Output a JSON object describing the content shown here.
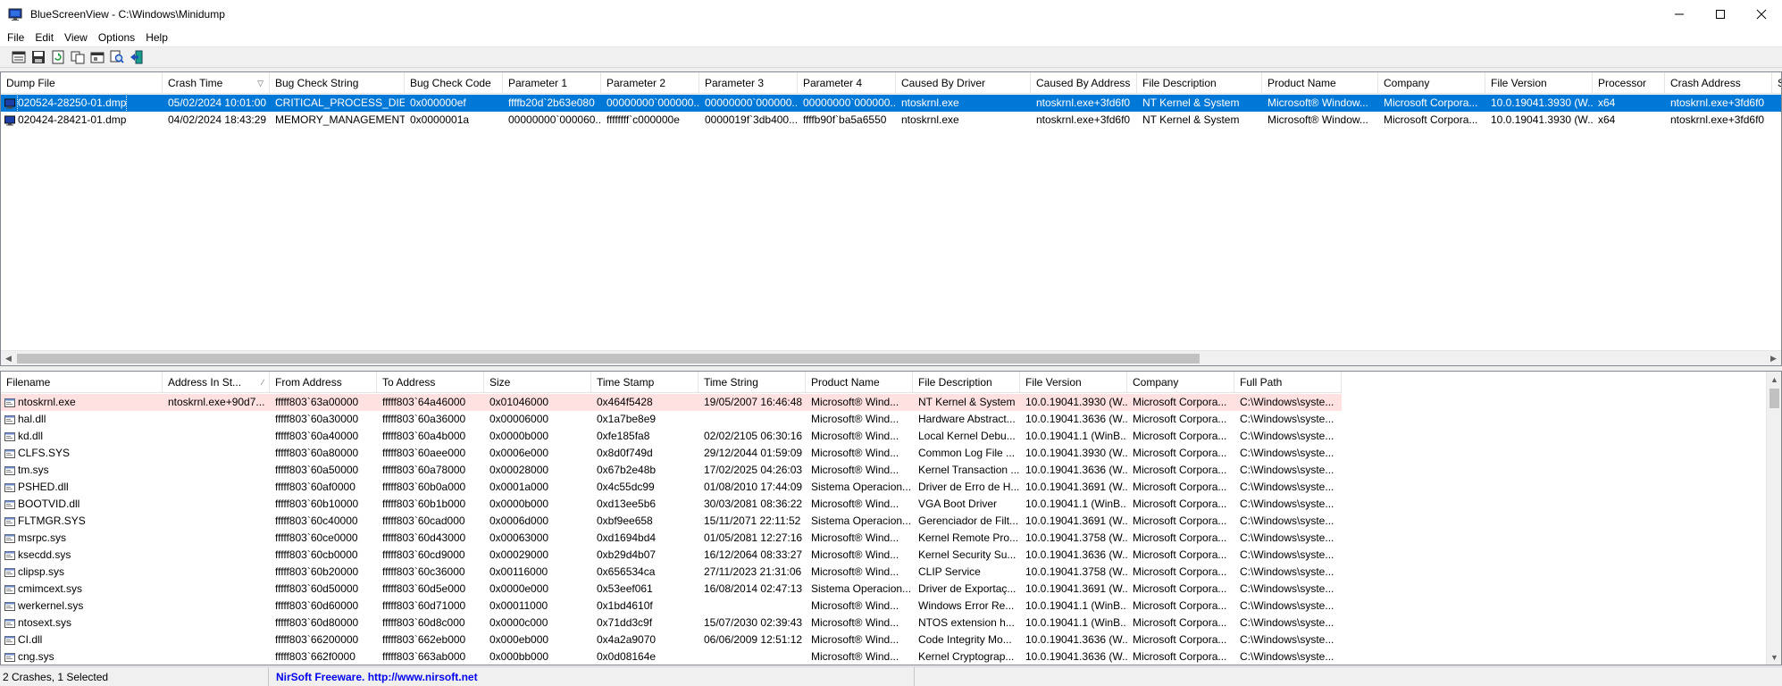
{
  "window": {
    "title": "BlueScreenView  -  C:\\Windows\\Minidump",
    "app_icon": "bluescreen-monitor-icon",
    "controls": [
      "minimize-icon",
      "maximize-icon",
      "close-icon"
    ]
  },
  "menu": [
    "File",
    "Edit",
    "View",
    "Options",
    "Help"
  ],
  "toolbar": [
    "properties-icon",
    "save-icon",
    "refresh-icon",
    "copy-icon",
    "advanced-options-icon",
    "find-icon",
    "exit-icon"
  ],
  "top_table": {
    "columns": [
      {
        "label": "Dump File",
        "sort": ""
      },
      {
        "label": "Crash Time",
        "sort": "▽"
      },
      {
        "label": "Bug Check String",
        "sort": ""
      },
      {
        "label": "Bug Check Code",
        "sort": ""
      },
      {
        "label": "Parameter 1",
        "sort": ""
      },
      {
        "label": "Parameter 2",
        "sort": ""
      },
      {
        "label": "Parameter 3",
        "sort": ""
      },
      {
        "label": "Parameter 4",
        "sort": ""
      },
      {
        "label": "Caused By Driver",
        "sort": ""
      },
      {
        "label": "Caused By Address",
        "sort": ""
      },
      {
        "label": "File Description",
        "sort": ""
      },
      {
        "label": "Product Name",
        "sort": ""
      },
      {
        "label": "Company",
        "sort": ""
      },
      {
        "label": "File Version",
        "sort": ""
      },
      {
        "label": "Processor",
        "sort": ""
      },
      {
        "label": "Crash Address",
        "sort": ""
      },
      {
        "label": "S",
        "sort": ""
      }
    ],
    "rows": [
      {
        "selected": true,
        "cells": [
          "020524-28250-01.dmp",
          "05/02/2024 10:01:00",
          "CRITICAL_PROCESS_DIED",
          "0x000000ef",
          "ffffb20d`2b63e080",
          "00000000`000000...",
          "00000000`000000...",
          "00000000`000000...",
          "ntoskrnl.exe",
          "ntoskrnl.exe+3fd6f0",
          "NT Kernel & System",
          "Microsoft® Window...",
          "Microsoft Corpora...",
          "10.0.19041.3930 (W...",
          "x64",
          "ntoskrnl.exe+3fd6f0",
          ""
        ]
      },
      {
        "selected": false,
        "cells": [
          "020424-28421-01.dmp",
          "04/02/2024 18:43:29",
          "MEMORY_MANAGEMENT",
          "0x0000001a",
          "00000000`000060...",
          "ffffffff`c000000e",
          "0000019f`3db400...",
          "ffffb90f`ba5a6550",
          "ntoskrnl.exe",
          "ntoskrnl.exe+3fd6f0",
          "NT Kernel & System",
          "Microsoft® Window...",
          "Microsoft Corpora...",
          "10.0.19041.3930 (W...",
          "x64",
          "ntoskrnl.exe+3fd6f0",
          ""
        ]
      }
    ]
  },
  "bottom_table": {
    "columns": [
      {
        "label": "Filename",
        "sort": ""
      },
      {
        "label": "Address In St...",
        "sort": "∕"
      },
      {
        "label": "From Address",
        "sort": ""
      },
      {
        "label": "To Address",
        "sort": ""
      },
      {
        "label": "Size",
        "sort": ""
      },
      {
        "label": "Time Stamp",
        "sort": ""
      },
      {
        "label": "Time String",
        "sort": ""
      },
      {
        "label": "Product Name",
        "sort": ""
      },
      {
        "label": "File Description",
        "sort": ""
      },
      {
        "label": "File Version",
        "sort": ""
      },
      {
        "label": "Company",
        "sort": ""
      },
      {
        "label": "Full Path",
        "sort": ""
      }
    ],
    "rows": [
      {
        "highlight": true,
        "cells": [
          "ntoskrnl.exe",
          "ntoskrnl.exe+90d7...",
          "fffff803`63a00000",
          "fffff803`64a46000",
          "0x01046000",
          "0x464f5428",
          "19/05/2007 16:46:48",
          "Microsoft® Wind...",
          "NT Kernel & System",
          "10.0.19041.3930 (W...",
          "Microsoft Corpora...",
          "C:\\Windows\\syste..."
        ]
      },
      {
        "highlight": false,
        "cells": [
          "hal.dll",
          "",
          "fffff803`60a30000",
          "fffff803`60a36000",
          "0x00006000",
          "0x1a7be8e9",
          "",
          "Microsoft® Wind...",
          "Hardware Abstract...",
          "10.0.19041.3636 (W...",
          "Microsoft Corpora...",
          "C:\\Windows\\syste..."
        ]
      },
      {
        "highlight": false,
        "cells": [
          "kd.dll",
          "",
          "fffff803`60a40000",
          "fffff803`60a4b000",
          "0x0000b000",
          "0xfe185fa8",
          "02/02/2105 06:30:16",
          "Microsoft® Wind...",
          "Local Kernel Debu...",
          "10.0.19041.1 (WinB...",
          "Microsoft Corpora...",
          "C:\\Windows\\syste..."
        ]
      },
      {
        "highlight": false,
        "cells": [
          "CLFS.SYS",
          "",
          "fffff803`60a80000",
          "fffff803`60aee000",
          "0x0006e000",
          "0x8d0f749d",
          "29/12/2044 01:59:09",
          "Microsoft® Wind...",
          "Common Log File ...",
          "10.0.19041.3930 (W...",
          "Microsoft Corpora...",
          "C:\\Windows\\syste..."
        ]
      },
      {
        "highlight": false,
        "cells": [
          "tm.sys",
          "",
          "fffff803`60a50000",
          "fffff803`60a78000",
          "0x00028000",
          "0x67b2e48b",
          "17/02/2025 04:26:03",
          "Microsoft® Wind...",
          "Kernel Transaction ...",
          "10.0.19041.3636 (W...",
          "Microsoft Corpora...",
          "C:\\Windows\\syste..."
        ]
      },
      {
        "highlight": false,
        "cells": [
          "PSHED.dll",
          "",
          "fffff803`60af0000",
          "fffff803`60b0a000",
          "0x0001a000",
          "0x4c55dc99",
          "01/08/2010 17:44:09",
          "Sistema Operacion...",
          "Driver de Erro de H...",
          "10.0.19041.3691 (W...",
          "Microsoft Corpora...",
          "C:\\Windows\\syste..."
        ]
      },
      {
        "highlight": false,
        "cells": [
          "BOOTVID.dll",
          "",
          "fffff803`60b10000",
          "fffff803`60b1b000",
          "0x0000b000",
          "0xd13ee5b6",
          "30/03/2081 08:36:22",
          "Microsoft® Wind...",
          "VGA Boot Driver",
          "10.0.19041.1 (WinB...",
          "Microsoft Corpora...",
          "C:\\Windows\\syste..."
        ]
      },
      {
        "highlight": false,
        "cells": [
          "FLTMGR.SYS",
          "",
          "fffff803`60c40000",
          "fffff803`60cad000",
          "0x0006d000",
          "0xbf9ee658",
          "15/11/2071 22:11:52",
          "Sistema Operacion...",
          "Gerenciador de Filt...",
          "10.0.19041.3691 (W...",
          "Microsoft Corpora...",
          "C:\\Windows\\syste..."
        ]
      },
      {
        "highlight": false,
        "cells": [
          "msrpc.sys",
          "",
          "fffff803`60ce0000",
          "fffff803`60d43000",
          "0x00063000",
          "0xd1694bd4",
          "01/05/2081 12:27:16",
          "Microsoft® Wind...",
          "Kernel Remote Pro...",
          "10.0.19041.3758 (W...",
          "Microsoft Corpora...",
          "C:\\Windows\\syste..."
        ]
      },
      {
        "highlight": false,
        "cells": [
          "ksecdd.sys",
          "",
          "fffff803`60cb0000",
          "fffff803`60cd9000",
          "0x00029000",
          "0xb29d4b07",
          "16/12/2064 08:33:27",
          "Microsoft® Wind...",
          "Kernel Security Su...",
          "10.0.19041.3636 (W...",
          "Microsoft Corpora...",
          "C:\\Windows\\syste..."
        ]
      },
      {
        "highlight": false,
        "cells": [
          "clipsp.sys",
          "",
          "fffff803`60b20000",
          "fffff803`60c36000",
          "0x00116000",
          "0x656534ca",
          "27/11/2023 21:31:06",
          "Microsoft® Wind...",
          "CLIP Service",
          "10.0.19041.3758 (W...",
          "Microsoft Corpora...",
          "C:\\Windows\\syste..."
        ]
      },
      {
        "highlight": false,
        "cells": [
          "cmimcext.sys",
          "",
          "fffff803`60d50000",
          "fffff803`60d5e000",
          "0x0000e000",
          "0x53eef061",
          "16/08/2014 02:47:13",
          "Sistema Operacion...",
          "Driver de Exportaç...",
          "10.0.19041.3691 (W...",
          "Microsoft Corpora...",
          "C:\\Windows\\syste..."
        ]
      },
      {
        "highlight": false,
        "cells": [
          "werkernel.sys",
          "",
          "fffff803`60d60000",
          "fffff803`60d71000",
          "0x00011000",
          "0x1bd4610f",
          "",
          "Microsoft® Wind...",
          "Windows Error Re...",
          "10.0.19041.1 (WinB...",
          "Microsoft Corpora...",
          "C:\\Windows\\syste..."
        ]
      },
      {
        "highlight": false,
        "cells": [
          "ntosext.sys",
          "",
          "fffff803`60d80000",
          "fffff803`60d8c000",
          "0x0000c000",
          "0x71dd3c9f",
          "15/07/2030 02:39:43",
          "Microsoft® Wind...",
          "NTOS extension h...",
          "10.0.19041.1 (WinB...",
          "Microsoft Corpora...",
          "C:\\Windows\\syste..."
        ]
      },
      {
        "highlight": false,
        "cells": [
          "CI.dll",
          "",
          "fffff803`66200000",
          "fffff803`662eb000",
          "0x000eb000",
          "0x4a2a9070",
          "06/06/2009 12:51:12",
          "Microsoft® Wind...",
          "Code Integrity Mo...",
          "10.0.19041.3636 (W...",
          "Microsoft Corpora...",
          "C:\\Windows\\syste..."
        ]
      },
      {
        "highlight": false,
        "cells": [
          "cng.sys",
          "",
          "fffff803`662f0000",
          "fffff803`663ab000",
          "0x000bb000",
          "0x0d08164e",
          "",
          "Microsoft® Wind...",
          "Kernel Cryptograp...",
          "10.0.19041.3636 (W...",
          "Microsoft Corpora...",
          "C:\\Windows\\syste..."
        ]
      }
    ]
  },
  "status": {
    "summary": "2 Crashes, 1 Selected",
    "link": "NirSoft Freeware.  http://www.nirsoft.net"
  },
  "colors": {
    "selection": "#0078d7",
    "highlight_row": "#ffe1e1",
    "link": "#0000ee"
  }
}
